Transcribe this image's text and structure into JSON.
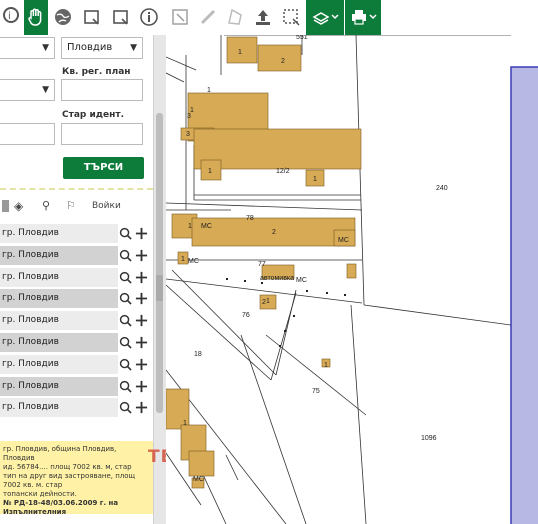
{
  "search": {
    "municipality_value": "Пловдив",
    "row2_value": "",
    "reg_plan_label": "Кв. рег. план",
    "reg_plan_value": "",
    "old_id_label": "Стар идент.",
    "old_id_value": "",
    "search_label": "ТЪРСИ"
  },
  "results": {
    "layers_label": "Войки",
    "rows": [
      {
        "label": "гр. Пловдив"
      },
      {
        "label": "гр. Пловдив"
      },
      {
        "label": "гр. Пловдив"
      },
      {
        "label": "гр. Пловдив"
      },
      {
        "label": "гр. Пловдив"
      },
      {
        "label": "гр. Пловдив"
      },
      {
        "label": "гр. Пловдив"
      },
      {
        "label": "гр. Пловдив"
      },
      {
        "label": "гр. Пловдив"
      }
    ]
  },
  "notice": {
    "line1": "гр. Пловдив, община Пловдив, Пловдив",
    "line2": "ид. 56784.... площ 7002 кв. м, стар",
    "line3": "тип на друг вид застрояване, площ 7002 кв. м. стар",
    "line4": "топански дейности.",
    "line5": "№ РД-18-48/03.06.2009 г. на Изпълнителния",
    "watermark": "ТЕООД"
  },
  "map": {
    "labels": [
      "551",
      "1",
      "2",
      "1",
      "3",
      "1",
      "3",
      "12/2",
      "1",
      "1",
      "240",
      "78",
      "1",
      "2",
      "МС",
      "МС",
      "1",
      "МС",
      "77",
      "автомивка",
      "МС",
      "1",
      "2",
      "76",
      "18",
      "75",
      "1",
      "1096",
      "1",
      "МС"
    ]
  }
}
